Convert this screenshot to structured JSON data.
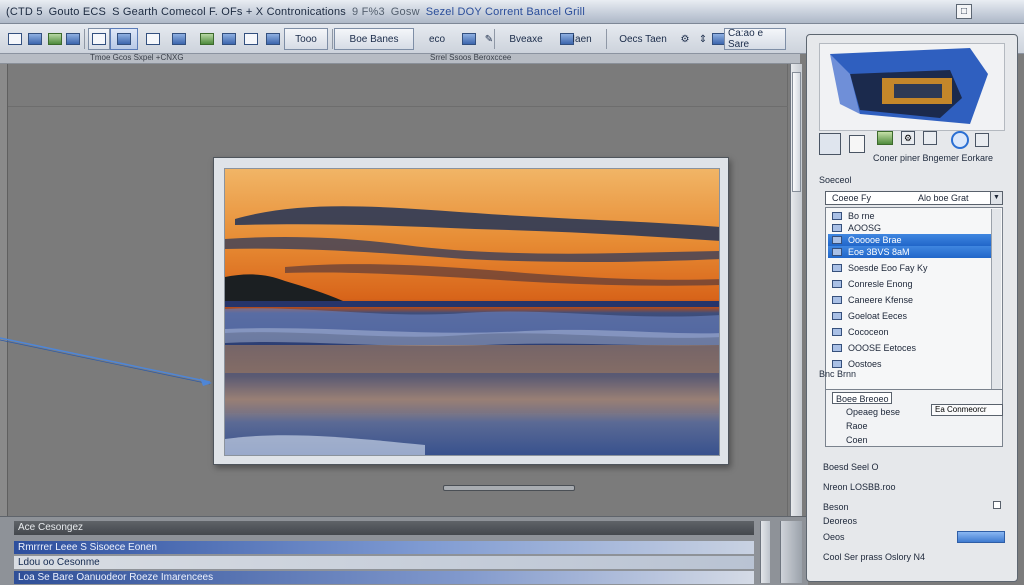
{
  "window": {
    "title_segments": [
      "(CTD 5",
      "Gouto ECS",
      "S Gearth Comecol F. OFs + X Contronications",
      "9 F%3",
      "Gosw",
      "Sezel DOY Corrent Bancel Grill"
    ],
    "restore_label": "□"
  },
  "toolbar": {
    "items": [
      "Tooo",
      "Boe Banes",
      "eco",
      "Bveaxe",
      "Iaen",
      "Oecs Taen",
      "Ca:ao e Sare"
    ],
    "strip_labels": [
      "Tmoe Gcos Sxpel +CNXG",
      "Srrel Ssoos Beroxccee"
    ]
  },
  "bottom_panel": {
    "header": "Ace Cesongez",
    "rows": [
      "Rmrrrer Leee S Sisoece Eonen",
      "Ldou oo Cesonme",
      "Loa Se Bare Oanuodeor Roeze Imarencees"
    ]
  },
  "right_panel": {
    "icon_caption": "Coner piner Bngemer Eorkare",
    "section_title": "Soeceol",
    "combo_value": "Coeoe Fy",
    "combo_right": "Alo boe Grat",
    "list_items": [
      {
        "label": "Bo rne",
        "selected": false
      },
      {
        "label": "AOOSG",
        "selected": false
      },
      {
        "label": "Oooooe Brae",
        "selected": true
      },
      {
        "label": "Eoe 3BVS 8aM",
        "selected": true
      },
      {
        "label": "Soesde Eoo Fay Ky",
        "selected": false
      },
      {
        "label": "Conresle Enong",
        "selected": false
      },
      {
        "label": "Caneere Kfense",
        "selected": false
      },
      {
        "label": "Goeloat Eeces",
        "selected": false
      },
      {
        "label": "Cococeon",
        "selected": false
      },
      {
        "label": "OOOSE Eetoces",
        "selected": false
      },
      {
        "label": "Oostoes",
        "selected": false
      }
    ],
    "lower_title": "Bnc Brnn",
    "lower_combo": "Boee Breoeo",
    "lower_items": [
      "Opeaeg bese",
      "Raoe",
      "Coen"
    ],
    "lower_field": "Ea Conmeorcr",
    "meta": [
      "Boesd Seel O",
      "Nreon LOSBB.roo",
      "Beson",
      "Deoreos"
    ],
    "footer_label": "Oeos",
    "footer_text": "Cool Ser prass Oslory N4"
  },
  "colors": {
    "selection": "#2a6fd3",
    "canvas_bg": "#7b7b7b",
    "panel_bg": "#e6e8eb"
  }
}
